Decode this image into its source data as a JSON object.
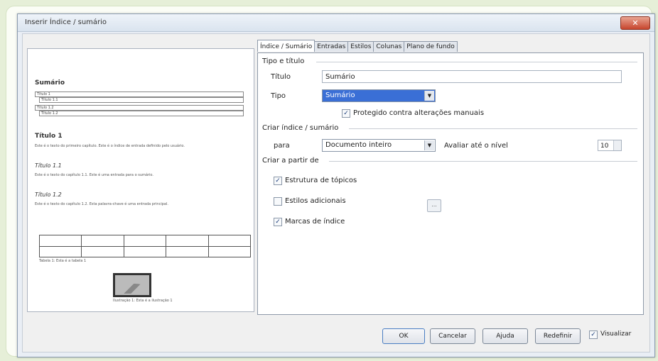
{
  "window": {
    "title": "Inserir Índice / sumário"
  },
  "preview": {
    "heading": "Sumário",
    "toc_lines": [
      "Título 1",
      "Título 1.1",
      "Título 1.2",
      "Título 1.2"
    ],
    "h1": "Título 1",
    "p1": "Este é o texto do primeiro capítulo. Este é o índice de entrada definido pelo usuário.",
    "h11": "Título 1.1",
    "p11": "Este é o texto do capítulo 1.1. Este é uma entrada para o sumário.",
    "h12": "Título 1.2",
    "p12": "Este é o texto do capítulo 1.2. Esta palavra-chave é uma entrada principal.",
    "table_caption": "Tabela 1: Esta é a tabela 1",
    "image_caption": "Ilustração 1: Esta é a ilustração 1"
  },
  "tabs": [
    "Índice / Sumário",
    "Entradas",
    "Estilos",
    "Colunas",
    "Plano de fundo"
  ],
  "type_title": {
    "section": "Tipo e título",
    "title_label": "Título",
    "title_value": "Sumário",
    "type_label": "Tipo",
    "type_value": "Sumário",
    "protected_label": "Protegido contra alterações manuais"
  },
  "create_index": {
    "section": "Criar índice / sumário",
    "for_label": "para",
    "for_value": "Documento inteiro",
    "level_label": "Avaliar até o nível",
    "level_value": "10"
  },
  "create_from": {
    "section": "Criar a partir de",
    "outline_label": "Estrutura de tópicos",
    "styles_label": "Estilos adicionais",
    "marks_label": "Marcas de índice",
    "more_button": "..."
  },
  "buttons": {
    "ok": "OK",
    "cancel": "Cancelar",
    "help": "Ajuda",
    "reset": "Redefinir",
    "preview": "Visualizar"
  },
  "checks": {
    "protected": "✓",
    "outline": "✓",
    "styles": "",
    "marks": "✓",
    "preview": "✓"
  },
  "colors": {
    "accent": "#3a6fd6",
    "close": "#c7452d"
  },
  "icons": {
    "close": "close-icon",
    "dropdown": "chevron-down-icon"
  }
}
